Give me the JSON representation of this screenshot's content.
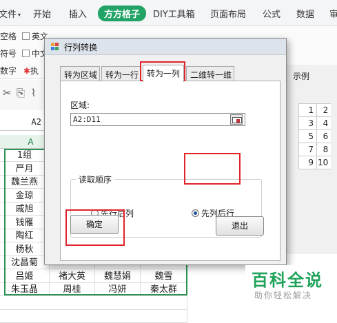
{
  "ribbon": {
    "tabs": [
      {
        "label": "文件",
        "caret": "▾"
      },
      {
        "label": "开始"
      },
      {
        "label": "插入"
      },
      {
        "label": "方方格子",
        "active": true
      },
      {
        "label": "DIY工具箱"
      },
      {
        "label": "页面布局"
      },
      {
        "label": "公式"
      },
      {
        "label": "数据"
      },
      {
        "label": "审"
      }
    ],
    "options": [
      {
        "label": "空格",
        "checkbox_label": "英文"
      },
      {
        "label": "符号",
        "checkbox_label": "中文"
      },
      {
        "label": "数字",
        "star_label": "执"
      }
    ],
    "toolbar_icons": [
      "cut-icon",
      "copy-icon",
      "format-painter-icon"
    ],
    "accent_color": "#21a366"
  },
  "name_box": {
    "value": "A2"
  },
  "sheet": {
    "column_header": "A",
    "header_row": [
      "1组"
    ],
    "rows": [
      [
        "严月"
      ],
      [
        "魏兰燕"
      ],
      [
        "金琼"
      ],
      [
        "戚旭"
      ],
      [
        "钱雁"
      ],
      [
        "陶红"
      ],
      [
        "杨秋"
      ],
      [
        "沈昌菊"
      ],
      [
        "吕姬",
        "褚大英",
        "魏慧娟",
        "魏雪"
      ],
      [
        "朱玉晶",
        "周桂",
        "冯妍",
        "秦太群"
      ]
    ]
  },
  "example": {
    "title": "示例",
    "rows": [
      [
        "1",
        "2"
      ],
      [
        "3",
        "4"
      ],
      [
        "5",
        "6"
      ],
      [
        "7",
        "8"
      ],
      [
        "9",
        "10"
      ]
    ]
  },
  "dialog": {
    "title": "行列转换",
    "tabs": [
      "转为区域",
      "转为一行",
      "转为一列",
      "二维转一维"
    ],
    "active_tab_index": 2,
    "area_label": "区域:",
    "area_value": "A2:D11",
    "order_group_title": "读取顺序",
    "order_options": [
      {
        "label": "先行后列",
        "checked": false
      },
      {
        "label": "先列后行",
        "checked": true
      }
    ],
    "ok_label": "确定",
    "exit_label": "退出",
    "highlight_color": "#e0232a"
  },
  "watermark": {
    "title": "百科全说",
    "subtitle": "助你轻松解决"
  }
}
